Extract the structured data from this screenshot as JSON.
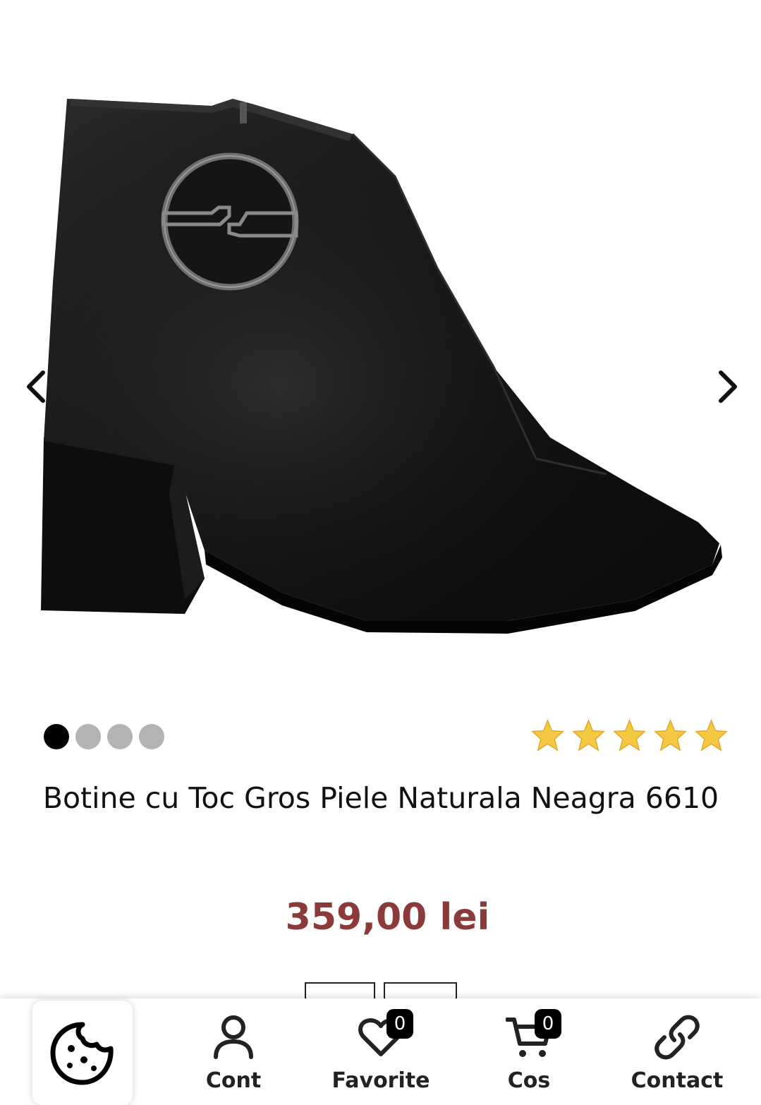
{
  "product": {
    "title": "Botine cu Toc Gros Piele Naturala Neagra 6610",
    "price": "359,00 lei",
    "rating_stars": 5,
    "rating_max": 5,
    "image_count": 4,
    "active_image": 1
  },
  "gallery": {
    "prev_icon": "chevron-left-icon",
    "next_icon": "chevron-right-icon"
  },
  "bottom_nav": {
    "cookie_icon": "cookie-icon",
    "items": [
      {
        "label": "Cont",
        "icon": "user-icon"
      },
      {
        "label": "Favorite",
        "icon": "heart-icon",
        "badge": "0"
      },
      {
        "label": "Cos",
        "icon": "cart-icon",
        "badge": "0"
      },
      {
        "label": "Contact",
        "icon": "link-icon"
      }
    ]
  },
  "colors": {
    "price": "#8b3a3a",
    "star": "#f5c842",
    "dot_active": "#000000",
    "dot_inactive": "#b3b3b3"
  }
}
